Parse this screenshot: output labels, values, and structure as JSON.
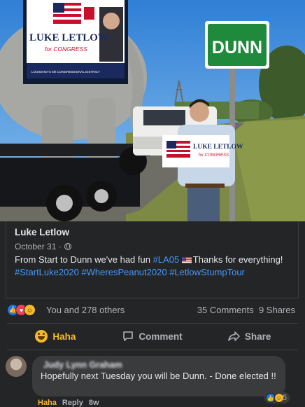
{
  "photo": {
    "billboard_name": "LUKE LETLOW",
    "billboard_sub": "for CONGRESS",
    "billboard_footer": "LOUISIANA'S 5th CONGRESSIONAL DISTRICT",
    "road_sign": "DUNN",
    "handheld_name": "LUKE LETLOW",
    "handheld_sub": "for CONGRESS"
  },
  "post": {
    "author": "Luke Letlow",
    "date": "October 31 ·",
    "text_start": "From Start to Dunn we've had fun ",
    "tag1": "#LA05",
    "text_mid": "Thanks for everything! ",
    "tag2": "#StartLuke2020",
    "tag3": "#WheresPeanut2020",
    "tag4": "#LetlowStumpTour"
  },
  "reactions": {
    "others": "You and 278 others",
    "comments": "35 Comments",
    "shares": "9 Shares"
  },
  "actions": {
    "haha": "Haha",
    "comment": "Comment",
    "share": "Share"
  },
  "comment": {
    "author": "Judy Lynn Graham",
    "text": "Hopefully next Tuesday you will be Dunn. - Done elected !!",
    "reaction_count": "5",
    "footer_haha": "Haha",
    "footer_reply": "Reply",
    "footer_time": "8w"
  },
  "colors": {
    "background": "#242526",
    "hashtag": "#4599ff",
    "haha_active": "#f7b928",
    "road_sign_green": "#1f8a3c"
  }
}
